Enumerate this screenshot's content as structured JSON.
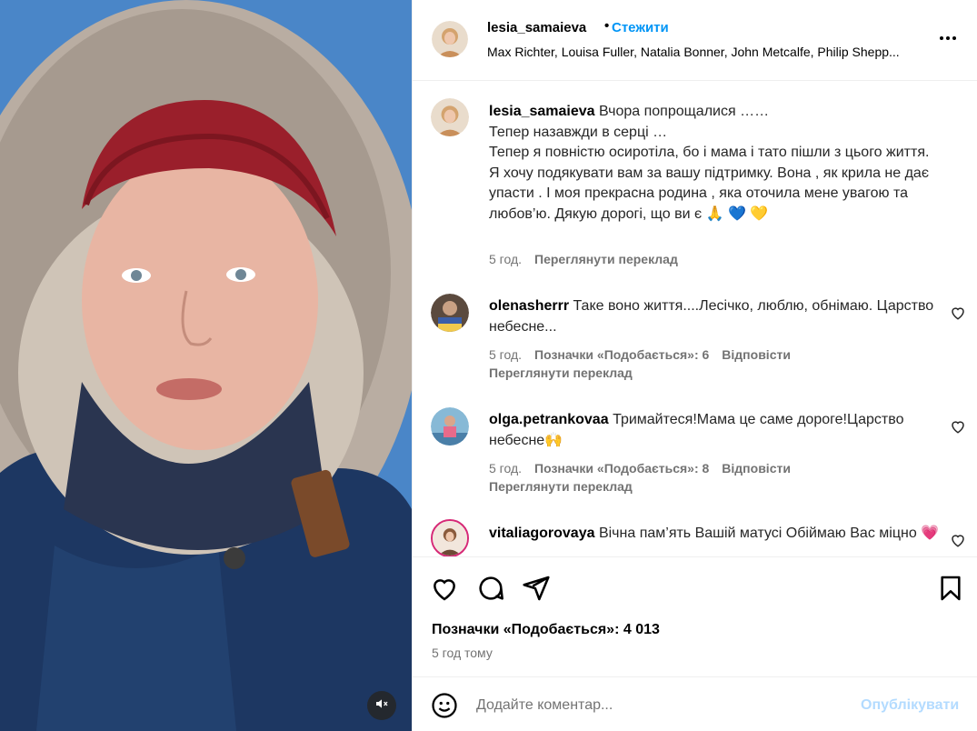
{
  "colors": {
    "accent": "#0095f6",
    "muted": "#737373",
    "publish_disabled": "#b3dbff"
  },
  "header": {
    "username": "lesia_samaieva",
    "separator": "•",
    "follow_label": "Стежити",
    "audio": "Max Richter, Louisa Fuller, Natalia Bonner, John Metcalfe, Philip Shepp...",
    "more_icon": "more-horizontal-icon"
  },
  "caption": {
    "username": "lesia_samaieva",
    "lines": [
      "Вчора попрощалися ……",
      "Тепер назавжди в серці …",
      "Тепер я повністю осиротіла, бо і мама і тато пішли з цього життя.",
      "Я хочу подякувати вам за вашу підтримку. Вона , як крила не дає упасти . І моя прекрасна родина , яка оточила мене увагою та любов’ю. Дякую дорогі, що ви є 🙏 💙 💛"
    ],
    "time": "5 год.",
    "translate_label": "Переглянути переклад"
  },
  "comments": [
    {
      "username": "olenasherrr",
      "text": "Таке воно життя....Лесічко, люблю, обнімаю. Царство небесне...",
      "time": "5 год.",
      "likes_label": "Позначки «Подобається»: 6",
      "reply_label": "Відповісти",
      "translate_label": "Переглянути переклад"
    },
    {
      "username": "olga.petrankovaa",
      "text": "Тримайтеся!Мама це саме дороге!Царство небесне🙌",
      "time": "5 год.",
      "likes_label": "Позначки «Подобається»: 8",
      "reply_label": "Відповісти",
      "translate_label": "Переглянути переклад"
    },
    {
      "username": "vitaliagorovaya",
      "text": "Вічна пам’ять Вашій матусі Обіймаю Вас міцно 💗"
    }
  ],
  "actions": {
    "like_icon": "heart-icon",
    "comment_icon": "comment-icon",
    "share_icon": "share-icon",
    "save_icon": "bookmark-icon",
    "likes": "Позначки «Подобається»: 4 013",
    "posted": "5 год тому"
  },
  "add_comment": {
    "placeholder": "Додайте коментар...",
    "publish_label": "Опублікувати",
    "emoji_icon": "emoji-icon"
  },
  "media": {
    "mute_icon": "sound-off-icon"
  }
}
